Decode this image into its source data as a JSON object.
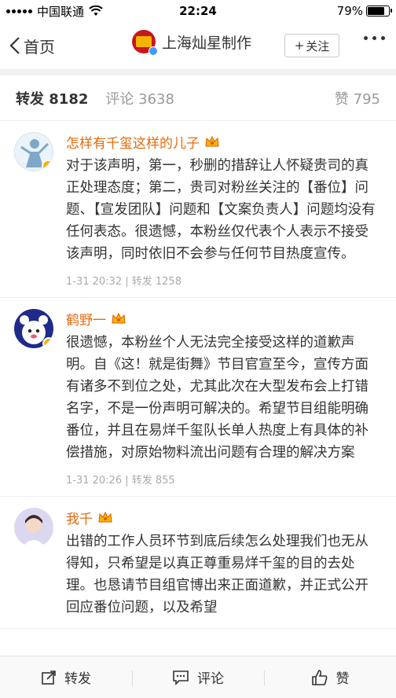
{
  "status": {
    "carrier": "中国联通",
    "time": "22:24",
    "battery": "79%",
    "battery_level": 0.79
  },
  "nav": {
    "back_label": "首页",
    "title": "上海灿星制作",
    "follow_label": "关注"
  },
  "tabs": {
    "repost_label": "转发",
    "repost_count": "8182",
    "comment_label": "评论",
    "comment_count": "3638",
    "like_label": "赞",
    "like_count": "795"
  },
  "posts": [
    {
      "author": "怎样有千玺这样的儿子",
      "text": "对于该声明，第一，秒删的措辞让人怀疑贵司的真正处理态度；第二，贵司对粉丝关注的【番位】问题、【宣发团队】问题和【文案负责人】问题均没有任何表态。很遗憾，本粉丝仅代表个人表示不接受该声明，同时依旧不会参与任何节目热度宣传。",
      "meta": "1-31 20:32 | 转发 1258"
    },
    {
      "author": "鹤野一",
      "text": "很遗憾，本粉丝个人无法完全接受这样的道歉声明。自《这！就是街舞》节目官宣至今，宣传方面有诸多不到位之处，尤其此次在大型发布会上打错名字，不是一份声明可解决的。希望节目组能明确番位，并且在易烊千玺队长单人热度上有具体的补偿措施，对原始物料流出问题有合理的解决方案",
      "meta": "1-31 20:26 | 转发 855"
    },
    {
      "author": "我千",
      "text": "出错的工作人员环节到底后续怎么处理我们也无从得知，只希望是以真正尊重易烊千玺的目的去处理。也恳请节目组官博出来正面道歉，并正式公开回应番位问题，以及希望",
      "meta": ""
    }
  ],
  "bottom": {
    "repost": "转发",
    "comment": "评论",
    "like": "赞"
  },
  "colors": {
    "author": "#e86b0c",
    "meta": "#aaaaaa",
    "badge_gold": "#f7b500",
    "badge_blue": "#3f9bff"
  }
}
